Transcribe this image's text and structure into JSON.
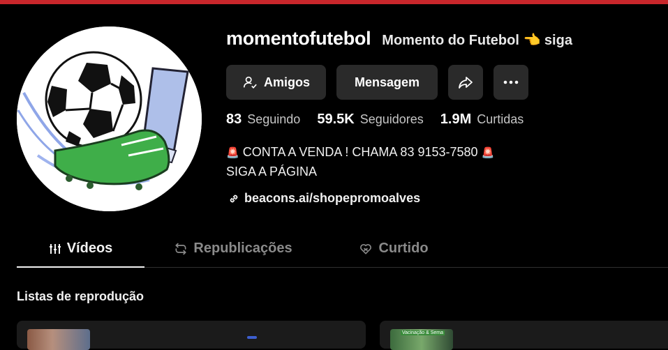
{
  "profile": {
    "username": "momentofutebol",
    "display_name": "Momento do Futebol 👈 siga"
  },
  "buttons": {
    "friends_label": "Amigos",
    "message_label": "Mensagem"
  },
  "stats": [
    {
      "value": "83",
      "label": "Seguindo"
    },
    {
      "value": "59.5K",
      "label": "Seguidores"
    },
    {
      "value": "1.9M",
      "label": "Curtidas"
    }
  ],
  "bio": {
    "line1_icon_left": "🚨",
    "line1_text": "CONTA A VENDA ! CHAMA 83 9153-7580",
    "line1_icon_right": "🚨",
    "line2_text": "SIGA A PÁGINA"
  },
  "link": {
    "text": "beacons.ai/shopepromoalves"
  },
  "tabs": [
    {
      "label": "Vídeos",
      "icon": "grid-lines-icon",
      "active": true
    },
    {
      "label": "Republicações",
      "icon": "repost-icon",
      "active": false
    },
    {
      "label": "Curtido",
      "icon": "heart-icon",
      "active": false
    }
  ],
  "playlists": {
    "title": "Listas de reprodução",
    "card2_tag": "Vacinação & Sema"
  },
  "colors": {
    "background": "#000000",
    "button_bg": "#2a2a2a",
    "top_bar": "#c8262b",
    "muted_text": "#8a8a8a"
  }
}
